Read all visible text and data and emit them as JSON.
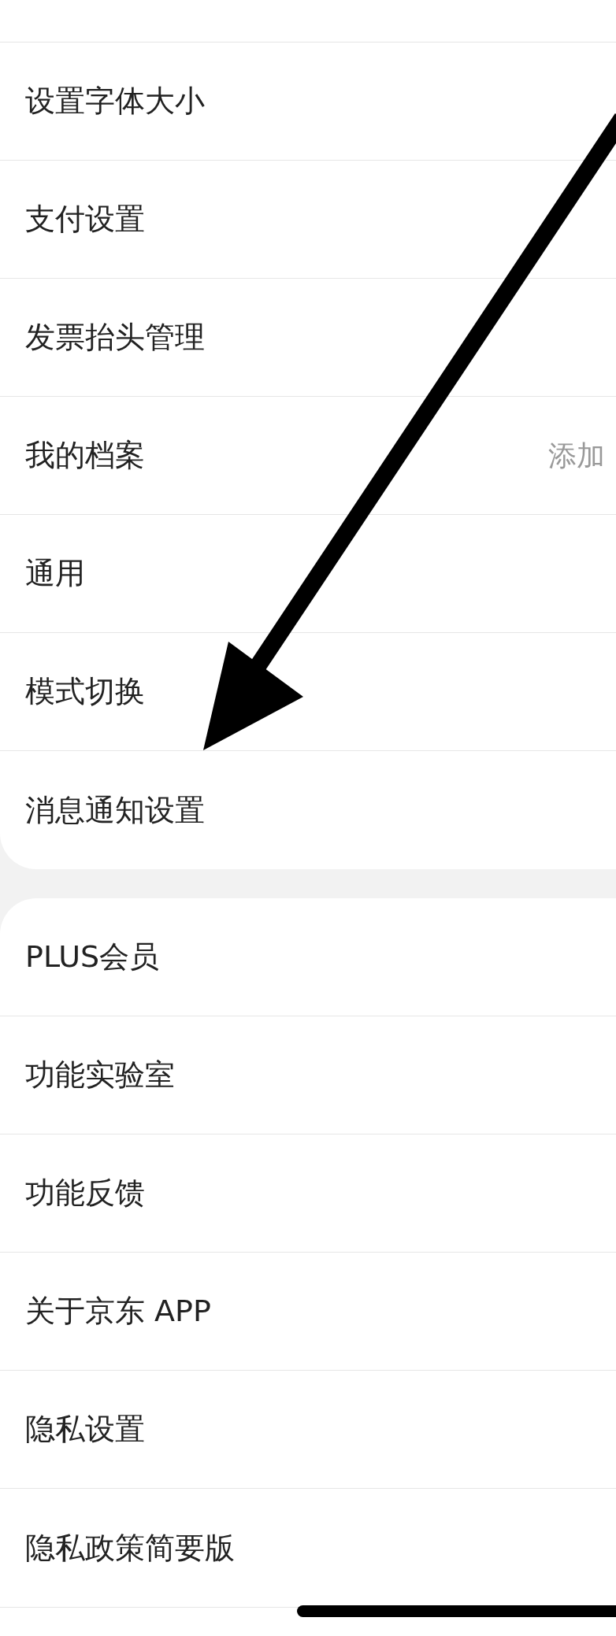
{
  "groups": [
    {
      "items": [
        {
          "label": "设置字体大小"
        },
        {
          "label": "支付设置"
        },
        {
          "label": "发票抬头管理"
        },
        {
          "label": "我的档案",
          "value": "添加"
        },
        {
          "label": "通用"
        },
        {
          "label": "模式切换"
        },
        {
          "label": "消息通知设置"
        }
      ]
    },
    {
      "items": [
        {
          "label": "PLUS会员"
        },
        {
          "label": "功能实验室"
        },
        {
          "label": "功能反馈"
        },
        {
          "label": "关于京东 APP"
        },
        {
          "label": "隐私设置"
        },
        {
          "label": "隐私政策简要版"
        }
      ]
    }
  ]
}
